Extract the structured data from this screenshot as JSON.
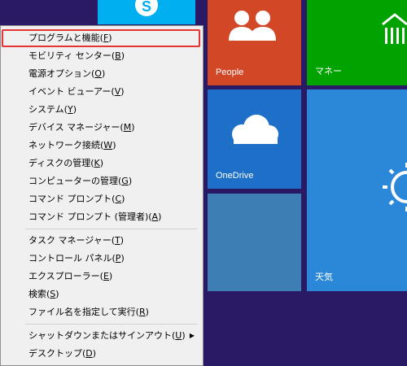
{
  "tiles": {
    "people": {
      "label": "People",
      "color": "#d24726"
    },
    "money": {
      "label": "マネー",
      "color": "#00a300"
    },
    "onedrive": {
      "label": "OneDrive",
      "color": "#1e6fc8"
    },
    "weather": {
      "label": "天気",
      "color": "#2b88d8"
    },
    "skype": {
      "color": "#00aff0"
    },
    "blank": {
      "color": "#3d7fb4"
    }
  },
  "menu": {
    "items": [
      {
        "label": "プログラムと機能(",
        "key": "F",
        "close": ")",
        "highlighted": true
      },
      {
        "label": "モビリティ センター(",
        "key": "B",
        "close": ")"
      },
      {
        "label": "電源オプション(",
        "key": "O",
        "close": ")"
      },
      {
        "label": "イベント ビューアー(",
        "key": "V",
        "close": ")"
      },
      {
        "label": "システム(",
        "key": "Y",
        "close": ")"
      },
      {
        "label": "デバイス マネージャー(",
        "key": "M",
        "close": ")"
      },
      {
        "label": "ネットワーク接続(",
        "key": "W",
        "close": ")"
      },
      {
        "label": "ディスクの管理(",
        "key": "K",
        "close": ")"
      },
      {
        "label": "コンピューターの管理(",
        "key": "G",
        "close": ")"
      },
      {
        "label": "コマンド プロンプト(",
        "key": "C",
        "close": ")"
      },
      {
        "label": "コマンド プロンプト (管理者)(",
        "key": "A",
        "close": ")"
      },
      {
        "label": "タスク マネージャー(",
        "key": "T",
        "close": ")"
      },
      {
        "label": "コントロール パネル(",
        "key": "P",
        "close": ")"
      },
      {
        "label": "エクスプローラー(",
        "key": "E",
        "close": ")"
      },
      {
        "label": "検索(",
        "key": "S",
        "close": ")"
      },
      {
        "label": "ファイル名を指定して実行(",
        "key": "R",
        "close": ")"
      },
      {
        "label": "シャットダウンまたはサインアウト(",
        "key": "U",
        "close": ")",
        "arrow": "▶"
      },
      {
        "label": "デスクトップ(",
        "key": "D",
        "close": ")"
      }
    ]
  }
}
